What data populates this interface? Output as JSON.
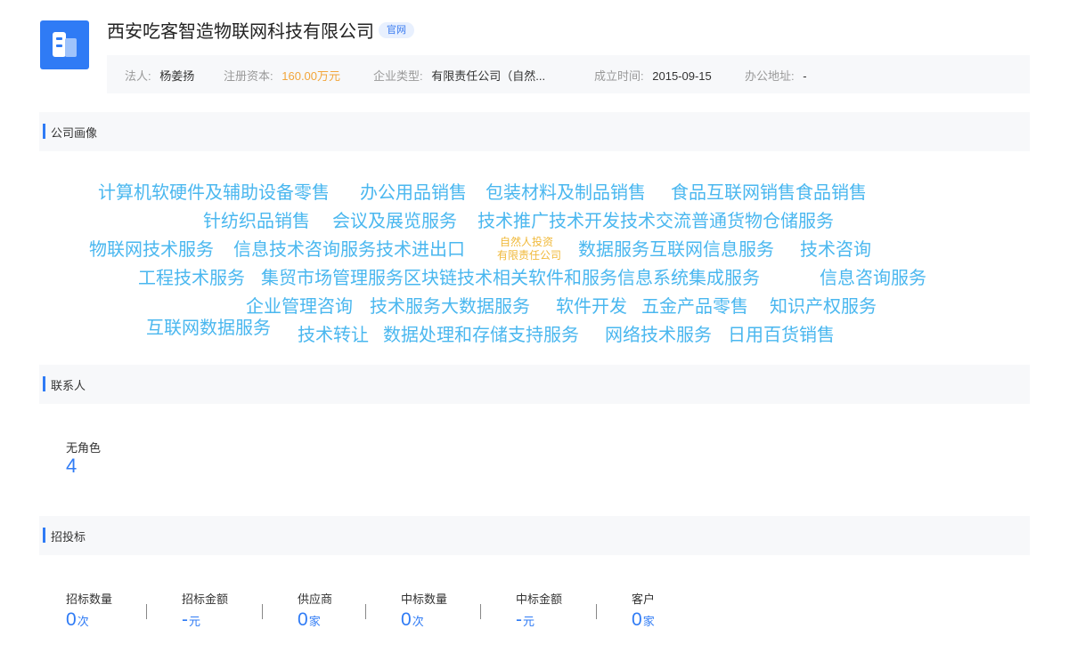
{
  "company": {
    "name": "西安吃客智造物联网科技有限公司",
    "official_tag": "官网"
  },
  "info": {
    "legal_person_label": "法人:",
    "legal_person": "杨姜扬",
    "capital_label": "注册资本:",
    "capital": "160.00万元",
    "type_label": "企业类型:",
    "type": "有限责任公司（自然...",
    "founded_label": "成立时间:",
    "founded": "2015-09-15",
    "address_label": "办公地址:",
    "address": "-"
  },
  "sections": {
    "portrait": "公司画像",
    "contacts": "联系人",
    "bidding": "招投标"
  },
  "cloud_words": [
    "计算机软硬件及辅助设备零售",
    "办公用品销售",
    "包装材料及制品销售",
    "食品互联网销售食品销售",
    "针纺织品销售",
    "会议及展览服务",
    "技术推广技术开发技术交流普通货物仓储服务",
    "物联网技术服务",
    "信息技术咨询服务技术进出口",
    "自然人投资",
    "有限责任公司",
    "数据服务互联网信息服务",
    "技术咨询",
    "工程技术服务",
    "集贸市场管理服务区块链技术相关软件和服务信息系统集成服务",
    "信息咨询服务",
    "企业管理咨询",
    "技术服务大数据服务",
    "软件开发",
    "五金产品零售",
    "知识产权服务",
    "互联网数据服务",
    "技术转让",
    "数据处理和存储支持服务",
    "网络技术服务",
    "日用百货销售"
  ],
  "contacts": {
    "role": "无角色",
    "count": "4"
  },
  "bidding_stats": [
    {
      "label": "招标数量",
      "value": "0",
      "unit": "次"
    },
    {
      "label": "招标金额",
      "value": "-",
      "unit": "元"
    },
    {
      "label": "供应商",
      "value": "0",
      "unit": "家"
    },
    {
      "label": "中标数量",
      "value": "0",
      "unit": "次"
    },
    {
      "label": "中标金额",
      "value": "-",
      "unit": "元"
    },
    {
      "label": "客户",
      "value": "0",
      "unit": "家"
    }
  ],
  "colors": {
    "accent": "#2f7bf5",
    "cloud_word": "#4ab7ef",
    "cloud_small": "#f0b93a",
    "capital": "#f2a53a"
  }
}
